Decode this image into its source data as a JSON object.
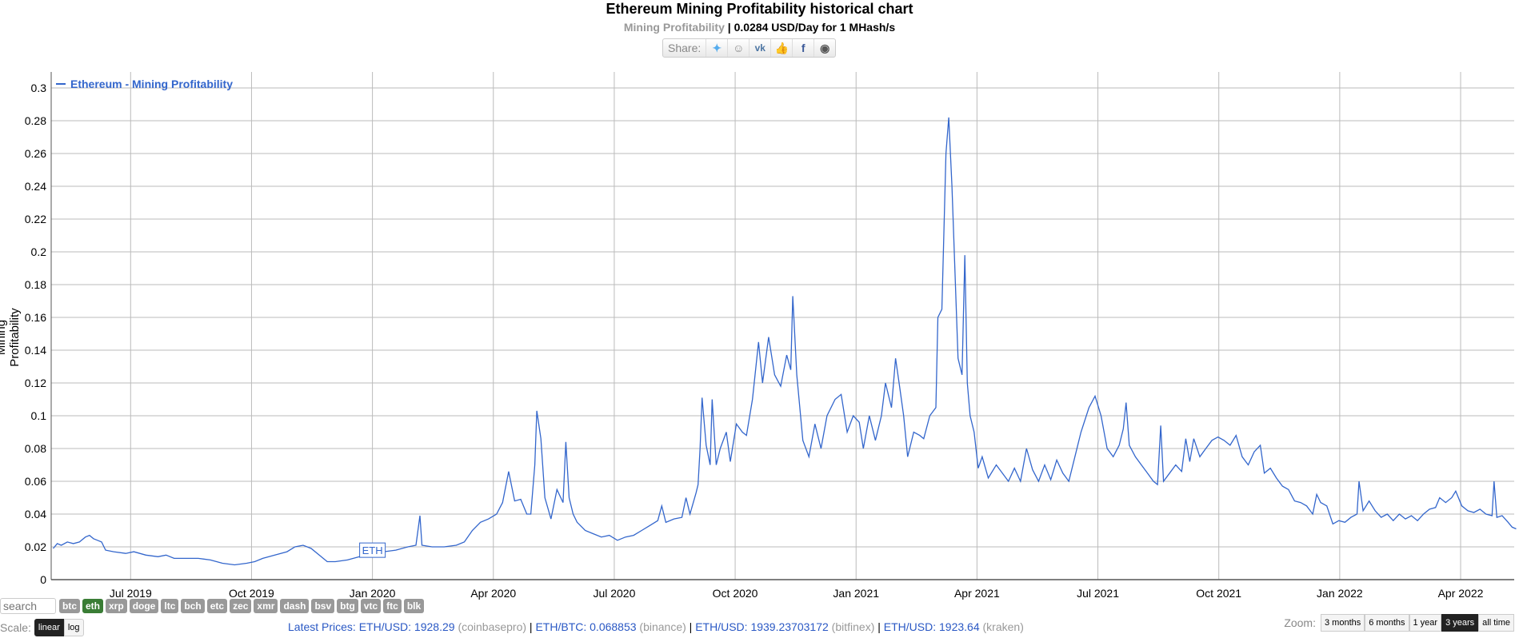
{
  "header": {
    "title": "Ethereum Mining Profitability historical chart",
    "subtitle_label": "Mining Profitability",
    "subtitle_value": " | 0.0284 USD/Day for 1 MHash/s",
    "share_label": "Share:",
    "share_icons": [
      "twitter-icon",
      "reddit-icon",
      "vk-icon",
      "like-icon",
      "facebook-icon",
      "weibo-icon"
    ]
  },
  "chart_data": {
    "type": "line",
    "title": "Ethereum Mining Profitability historical chart",
    "ylabel": "Mining Profitability",
    "xlabel": "",
    "ylim": [
      0,
      0.3
    ],
    "yticks": [
      "0",
      "0.02",
      "0.04",
      "0.06",
      "0.08",
      "0.1",
      "0.12",
      "0.14",
      "0.16",
      "0.18",
      "0.2",
      "0.22",
      "0.24",
      "0.26",
      "0.28",
      "0.3"
    ],
    "xticks": [
      "Jul 2019",
      "Oct 2019",
      "Jan 2020",
      "Apr 2020",
      "Jul 2020",
      "Oct 2020",
      "Jan 2021",
      "Apr 2021",
      "Jul 2021",
      "Oct 2021",
      "Jan 2022",
      "Apr 2022"
    ],
    "x_range": [
      "2019-05",
      "2022-05"
    ],
    "grid": true,
    "legend": {
      "label": "Ethereum - Mining Profitability",
      "position": "top-left"
    },
    "annotation": {
      "label": "ETH",
      "x": "Jan 2020"
    },
    "color": "#3366cc",
    "series": [
      {
        "name": "Ethereum - Mining Profitability",
        "points": [
          [
            0.0,
            0.019
          ],
          [
            0.1,
            0.022
          ],
          [
            0.2,
            0.021
          ],
          [
            0.35,
            0.023
          ],
          [
            0.5,
            0.022
          ],
          [
            0.65,
            0.023
          ],
          [
            0.8,
            0.026
          ],
          [
            0.9,
            0.027
          ],
          [
            1.0,
            0.025
          ],
          [
            1.1,
            0.024
          ],
          [
            1.2,
            0.023
          ],
          [
            1.3,
            0.018
          ],
          [
            1.5,
            0.017
          ],
          [
            1.8,
            0.016
          ],
          [
            2.0,
            0.017
          ],
          [
            2.3,
            0.015
          ],
          [
            2.6,
            0.014
          ],
          [
            2.8,
            0.015
          ],
          [
            3.0,
            0.013
          ],
          [
            3.3,
            0.013
          ],
          [
            3.6,
            0.013
          ],
          [
            3.9,
            0.012
          ],
          [
            4.2,
            0.01
          ],
          [
            4.5,
            0.009
          ],
          [
            4.8,
            0.01
          ],
          [
            5.0,
            0.011
          ],
          [
            5.2,
            0.013
          ],
          [
            5.5,
            0.015
          ],
          [
            5.8,
            0.017
          ],
          [
            6.0,
            0.02
          ],
          [
            6.2,
            0.021
          ],
          [
            6.4,
            0.019
          ],
          [
            6.6,
            0.015
          ],
          [
            6.8,
            0.011
          ],
          [
            7.0,
            0.011
          ],
          [
            7.3,
            0.012
          ],
          [
            7.6,
            0.014
          ],
          [
            7.9,
            0.015
          ],
          [
            8.2,
            0.017
          ],
          [
            8.5,
            0.018
          ],
          [
            8.8,
            0.02
          ],
          [
            9.0,
            0.021
          ],
          [
            9.1,
            0.039
          ],
          [
            9.15,
            0.021
          ],
          [
            9.4,
            0.02
          ],
          [
            9.7,
            0.02
          ],
          [
            10.0,
            0.021
          ],
          [
            10.2,
            0.023
          ],
          [
            10.4,
            0.03
          ],
          [
            10.6,
            0.035
          ],
          [
            10.8,
            0.037
          ],
          [
            11.0,
            0.04
          ],
          [
            11.15,
            0.047
          ],
          [
            11.3,
            0.066
          ],
          [
            11.45,
            0.048
          ],
          [
            11.6,
            0.049
          ],
          [
            11.75,
            0.04
          ],
          [
            11.85,
            0.04
          ],
          [
            11.95,
            0.07
          ],
          [
            12.0,
            0.103
          ],
          [
            12.1,
            0.086
          ],
          [
            12.2,
            0.05
          ],
          [
            12.35,
            0.037
          ],
          [
            12.5,
            0.055
          ],
          [
            12.65,
            0.047
          ],
          [
            12.72,
            0.084
          ],
          [
            12.8,
            0.05
          ],
          [
            12.9,
            0.04
          ],
          [
            13.0,
            0.035
          ],
          [
            13.2,
            0.03
          ],
          [
            13.4,
            0.028
          ],
          [
            13.6,
            0.026
          ],
          [
            13.8,
            0.027
          ],
          [
            14.0,
            0.024
          ],
          [
            14.2,
            0.026
          ],
          [
            14.4,
            0.027
          ],
          [
            14.6,
            0.03
          ],
          [
            14.8,
            0.033
          ],
          [
            15.0,
            0.036
          ],
          [
            15.1,
            0.045
          ],
          [
            15.2,
            0.035
          ],
          [
            15.4,
            0.037
          ],
          [
            15.6,
            0.038
          ],
          [
            15.7,
            0.05
          ],
          [
            15.8,
            0.04
          ],
          [
            15.95,
            0.053
          ],
          [
            16.0,
            0.058
          ],
          [
            16.05,
            0.08
          ],
          [
            16.1,
            0.111
          ],
          [
            16.2,
            0.082
          ],
          [
            16.3,
            0.07
          ],
          [
            16.35,
            0.11
          ],
          [
            16.45,
            0.07
          ],
          [
            16.55,
            0.08
          ],
          [
            16.7,
            0.09
          ],
          [
            16.8,
            0.072
          ],
          [
            16.95,
            0.095
          ],
          [
            17.1,
            0.09
          ],
          [
            17.2,
            0.088
          ],
          [
            17.35,
            0.11
          ],
          [
            17.5,
            0.145
          ],
          [
            17.6,
            0.12
          ],
          [
            17.75,
            0.148
          ],
          [
            17.9,
            0.125
          ],
          [
            18.05,
            0.118
          ],
          [
            18.2,
            0.137
          ],
          [
            18.3,
            0.128
          ],
          [
            18.35,
            0.173
          ],
          [
            18.45,
            0.125
          ],
          [
            18.6,
            0.085
          ],
          [
            18.75,
            0.075
          ],
          [
            18.9,
            0.095
          ],
          [
            19.05,
            0.08
          ],
          [
            19.2,
            0.1
          ],
          [
            19.4,
            0.11
          ],
          [
            19.55,
            0.113
          ],
          [
            19.7,
            0.09
          ],
          [
            19.85,
            0.1
          ],
          [
            20.0,
            0.096
          ],
          [
            20.1,
            0.08
          ],
          [
            20.25,
            0.1
          ],
          [
            20.4,
            0.085
          ],
          [
            20.55,
            0.1
          ],
          [
            20.65,
            0.12
          ],
          [
            20.8,
            0.105
          ],
          [
            20.9,
            0.135
          ],
          [
            21.0,
            0.118
          ],
          [
            21.1,
            0.1
          ],
          [
            21.2,
            0.075
          ],
          [
            21.35,
            0.09
          ],
          [
            21.5,
            0.088
          ],
          [
            21.6,
            0.086
          ],
          [
            21.75,
            0.1
          ],
          [
            21.9,
            0.105
          ],
          [
            21.95,
            0.16
          ],
          [
            22.05,
            0.165
          ],
          [
            22.15,
            0.26
          ],
          [
            22.22,
            0.282
          ],
          [
            22.3,
            0.24
          ],
          [
            22.45,
            0.135
          ],
          [
            22.55,
            0.125
          ],
          [
            22.62,
            0.198
          ],
          [
            22.68,
            0.12
          ],
          [
            22.75,
            0.1
          ],
          [
            22.85,
            0.09
          ],
          [
            22.95,
            0.068
          ],
          [
            23.05,
            0.075
          ],
          [
            23.2,
            0.062
          ],
          [
            23.4,
            0.07
          ],
          [
            23.55,
            0.065
          ],
          [
            23.7,
            0.06
          ],
          [
            23.85,
            0.068
          ],
          [
            24.0,
            0.06
          ],
          [
            24.15,
            0.08
          ],
          [
            24.3,
            0.067
          ],
          [
            24.45,
            0.06
          ],
          [
            24.6,
            0.07
          ],
          [
            24.75,
            0.061
          ],
          [
            24.9,
            0.073
          ],
          [
            25.05,
            0.065
          ],
          [
            25.2,
            0.06
          ],
          [
            25.35,
            0.075
          ],
          [
            25.5,
            0.09
          ],
          [
            25.7,
            0.105
          ],
          [
            25.85,
            0.112
          ],
          [
            26.0,
            0.1
          ],
          [
            26.15,
            0.08
          ],
          [
            26.3,
            0.075
          ],
          [
            26.45,
            0.082
          ],
          [
            26.55,
            0.092
          ],
          [
            26.62,
            0.108
          ],
          [
            26.7,
            0.082
          ],
          [
            26.85,
            0.075
          ],
          [
            27.0,
            0.07
          ],
          [
            27.15,
            0.065
          ],
          [
            27.3,
            0.06
          ],
          [
            27.4,
            0.058
          ],
          [
            27.48,
            0.094
          ],
          [
            27.55,
            0.06
          ],
          [
            27.7,
            0.065
          ],
          [
            27.85,
            0.07
          ],
          [
            28.0,
            0.066
          ],
          [
            28.1,
            0.086
          ],
          [
            28.2,
            0.072
          ],
          [
            28.3,
            0.086
          ],
          [
            28.45,
            0.075
          ],
          [
            28.6,
            0.08
          ],
          [
            28.75,
            0.085
          ],
          [
            28.9,
            0.087
          ],
          [
            29.05,
            0.085
          ],
          [
            29.2,
            0.082
          ],
          [
            29.35,
            0.088
          ],
          [
            29.5,
            0.075
          ],
          [
            29.65,
            0.07
          ],
          [
            29.8,
            0.078
          ],
          [
            29.95,
            0.082
          ],
          [
            30.05,
            0.065
          ],
          [
            30.2,
            0.068
          ],
          [
            30.35,
            0.062
          ],
          [
            30.5,
            0.057
          ],
          [
            30.65,
            0.055
          ],
          [
            30.8,
            0.048
          ],
          [
            30.95,
            0.047
          ],
          [
            31.1,
            0.045
          ],
          [
            31.25,
            0.04
          ],
          [
            31.35,
            0.052
          ],
          [
            31.45,
            0.047
          ],
          [
            31.6,
            0.045
          ],
          [
            31.75,
            0.034
          ],
          [
            31.9,
            0.036
          ],
          [
            32.05,
            0.035
          ],
          [
            32.2,
            0.038
          ],
          [
            32.35,
            0.04
          ],
          [
            32.4,
            0.06
          ],
          [
            32.5,
            0.042
          ],
          [
            32.65,
            0.048
          ],
          [
            32.8,
            0.042
          ],
          [
            32.95,
            0.038
          ],
          [
            33.1,
            0.04
          ],
          [
            33.25,
            0.036
          ],
          [
            33.4,
            0.04
          ],
          [
            33.55,
            0.037
          ],
          [
            33.7,
            0.039
          ],
          [
            33.85,
            0.036
          ],
          [
            34.0,
            0.04
          ],
          [
            34.15,
            0.043
          ],
          [
            34.3,
            0.044
          ],
          [
            34.4,
            0.05
          ],
          [
            34.55,
            0.047
          ],
          [
            34.7,
            0.05
          ],
          [
            34.8,
            0.054
          ],
          [
            34.95,
            0.045
          ],
          [
            35.1,
            0.042
          ],
          [
            35.25,
            0.041
          ],
          [
            35.4,
            0.043
          ],
          [
            35.55,
            0.04
          ],
          [
            35.7,
            0.039
          ],
          [
            35.75,
            0.06
          ],
          [
            35.82,
            0.038
          ],
          [
            35.95,
            0.039
          ],
          [
            36.1,
            0.035
          ],
          [
            36.2,
            0.032
          ],
          [
            36.3,
            0.031
          ]
        ]
      }
    ]
  },
  "footer": {
    "search_placeholder": "search",
    "coins": [
      "btc",
      "eth",
      "xrp",
      "doge",
      "ltc",
      "bch",
      "etc",
      "zec",
      "xmr",
      "dash",
      "bsv",
      "btg",
      "vtc",
      "ftc",
      "blk"
    ],
    "active_coin": "eth",
    "scale_label": "Scale:",
    "scale_options": [
      "linear",
      "log"
    ],
    "latest_prices_label": "Latest Prices: ",
    "prices": [
      {
        "pair": "ETH/USD: 1928.29",
        "source": "(coinbasepro)"
      },
      {
        "pair": "ETH/BTC: 0.068853",
        "source": "(binance)"
      },
      {
        "pair": "ETH/USD: 1939.23703172",
        "source": "(bitfinex)"
      },
      {
        "pair": "ETH/USD: 1923.64",
        "source": "(kraken)"
      }
    ],
    "zoom_label": "Zoom:",
    "zoom_options": [
      "3 months",
      "6 months",
      "1 year",
      "3 years",
      "all time"
    ],
    "zoom_active": "3 years"
  }
}
